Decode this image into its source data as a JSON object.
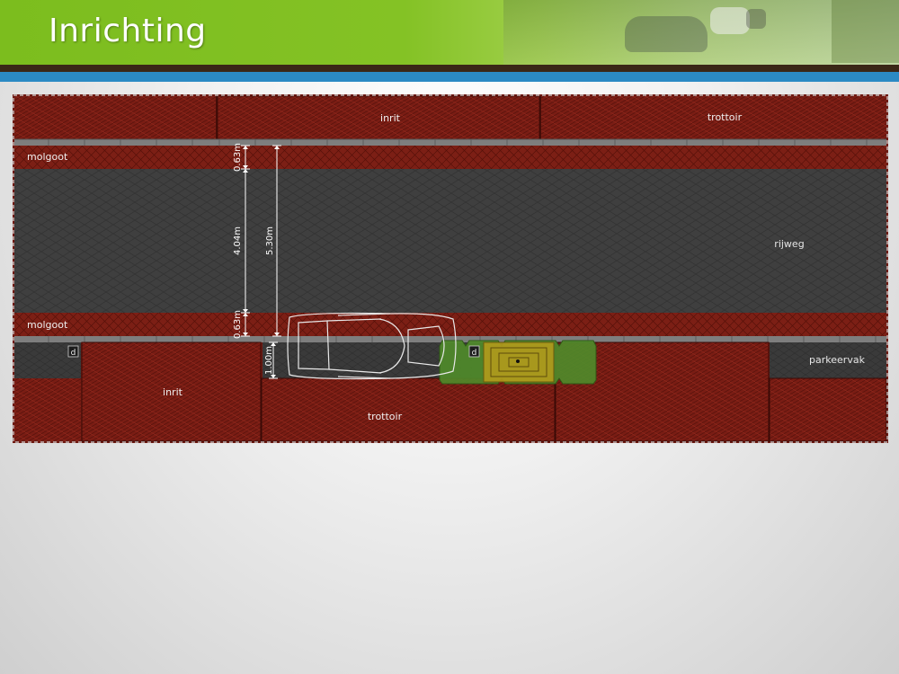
{
  "slide": {
    "title": "Inrichting"
  },
  "plan": {
    "labels": {
      "inrit_top": "inrit",
      "trottoir_top": "trottoir",
      "molgoot_top": "molgoot",
      "rijweg": "rijweg",
      "molgoot_bottom": "molgoot",
      "inrit_bottom": "inrit",
      "trottoir_bottom": "trottoir",
      "parkeervak": "parkeervak",
      "drain_1": "d",
      "drain_2": "d"
    },
    "dimensions": {
      "dim_063_top": "0.63m",
      "dim_404": "4.04m",
      "dim_063_bottom": "0.63m",
      "dim_530": "5.30m",
      "dim_100": "1.00m"
    },
    "colors": {
      "brick": "#7a1d14",
      "asphalt": "#3e3e3e",
      "curb": "#8a8a8a",
      "tree_zone": "#4f8a2a",
      "tree_pit": "#b39a1c"
    }
  }
}
